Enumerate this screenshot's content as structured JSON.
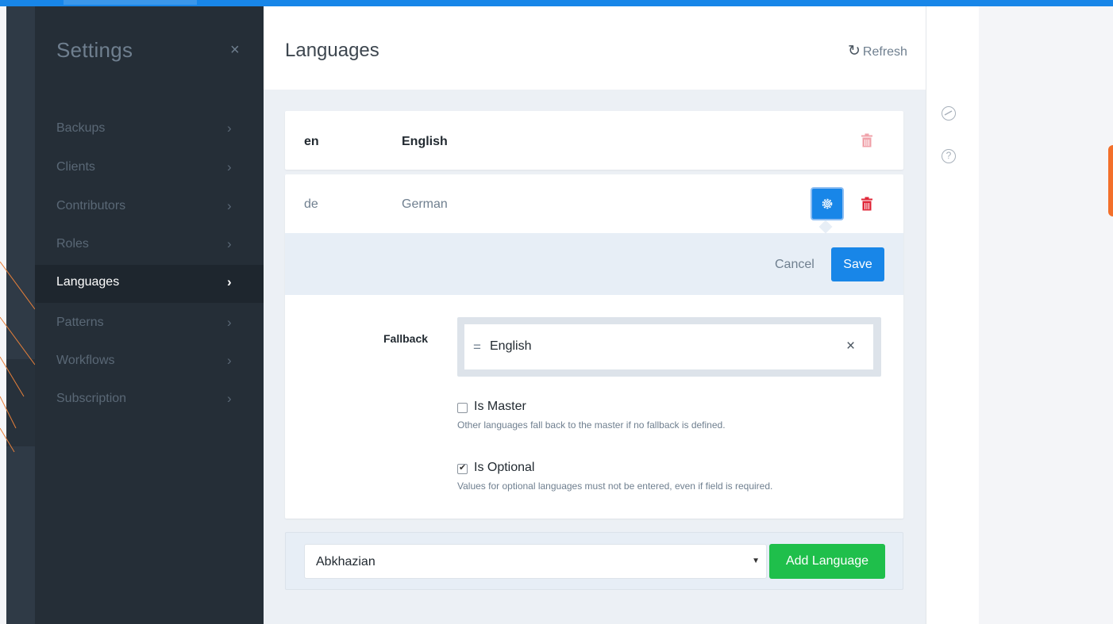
{
  "settings": {
    "title": "Settings",
    "close_icon": "×",
    "items": [
      {
        "label": "Backups",
        "active": false
      },
      {
        "label": "Clients",
        "active": false
      },
      {
        "label": "Contributors",
        "active": false
      },
      {
        "label": "Roles",
        "active": false
      },
      {
        "label": "Languages",
        "active": true
      },
      {
        "label": "Patterns",
        "active": false
      },
      {
        "label": "Workflows",
        "active": false
      },
      {
        "label": "Subscription",
        "active": false
      }
    ],
    "chevron": "›"
  },
  "panel": {
    "title": "Languages",
    "refresh_label": "Refresh",
    "refresh_icon": "↻",
    "close_icon": "×"
  },
  "languages": [
    {
      "code": "en",
      "name": "English",
      "is_master": true
    },
    {
      "code": "de",
      "name": "German",
      "is_master": false
    }
  ],
  "edit": {
    "cancel_label": "Cancel",
    "save_label": "Save",
    "fallback_label": "Fallback",
    "fallback_value": "English",
    "fallback_grip": "=",
    "fallback_remove": "×",
    "is_master_label": "Is Master",
    "is_master_checked": false,
    "is_master_hint": "Other languages fall back to the master if no fallback is defined.",
    "is_optional_label": "Is Optional",
    "is_optional_checked": true,
    "is_optional_hint": "Values for optional languages must not be entered, even if field is required."
  },
  "add": {
    "selected": "Abkhazian",
    "caret": "▼",
    "button_label": "Add Language"
  },
  "colors": {
    "accent": "#1886e8",
    "success": "#1fbf4b",
    "danger": "#e0283a",
    "sidebar_bg": "#252e37"
  },
  "icons": {
    "trash": "trash-icon",
    "gear": "gear-icon",
    "history": "history-icon",
    "help": "help-icon"
  }
}
